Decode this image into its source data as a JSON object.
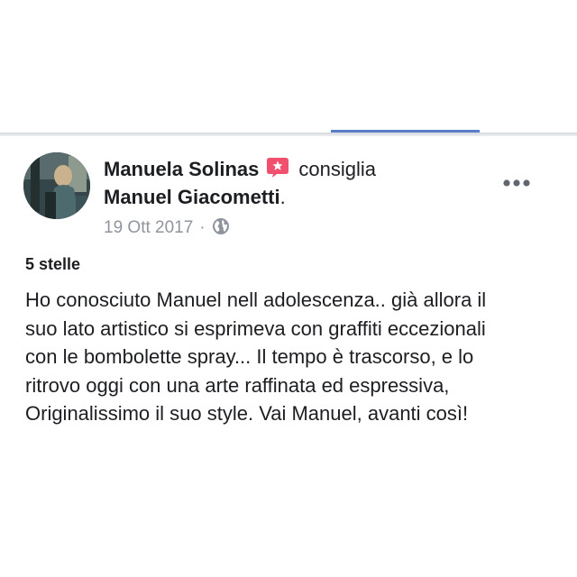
{
  "post": {
    "author": "Manuela Solinas",
    "verb": "consiglia",
    "target": "Manuel Giacometti",
    "target_suffix": ".",
    "date": "19 Ott 2017",
    "separator": "·",
    "privacy_icon": "globe-icon",
    "recommend_icon": "recommend-star-icon",
    "more_icon": "more-options-icon",
    "rating": "5 stelle",
    "review_lines": [
      "Ho conosciuto Manuel nell adolescenza.. già allora il",
      "suo lato artistico si esprimeva con graffiti eccezionali",
      "con le bombolette spray...   Il tempo è trascorso, e lo",
      "ritrovo oggi con una arte raffinata ed espressiva,",
      "Originalissimo il suo style. Vai Manuel, avanti così!"
    ]
  },
  "colors": {
    "recommend_badge": "#f0506e",
    "tab_indicator": "#5b7ec9",
    "meta_text": "#90949c"
  }
}
